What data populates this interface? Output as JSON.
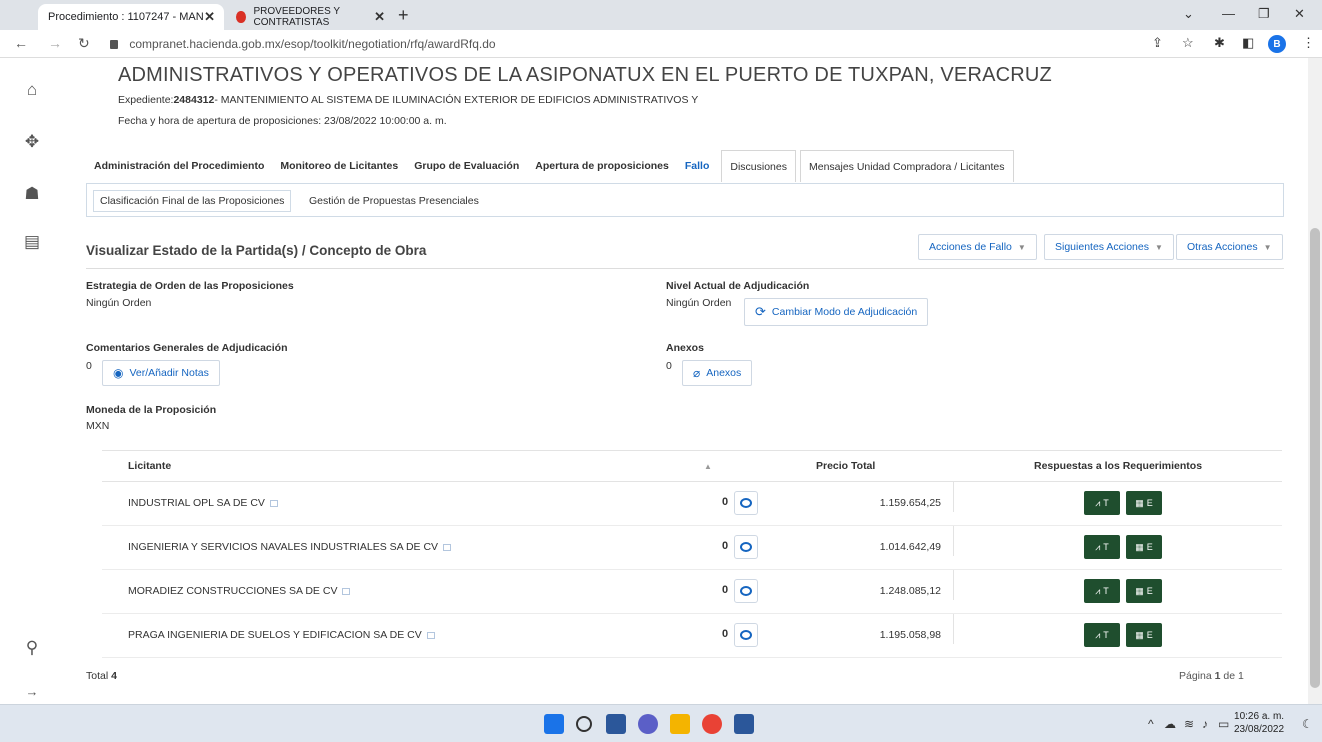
{
  "browser": {
    "tabs": [
      {
        "title": "Procedimiento : 1107247 - MAN",
        "active": true
      },
      {
        "title": "PROVEEDORES Y CONTRATISTAS",
        "active": false
      }
    ],
    "url": "compranet.hacienda.gob.mx/esop/toolkit/negotiation/rfq/awardRfq.do",
    "profile_initial": "B"
  },
  "header": {
    "title": "ADMINISTRATIVOS Y OPERATIVOS DE LA ASIPONATUX EN EL PUERTO DE TUXPAN, VERACRUZ",
    "expediente_label": "Expediente:",
    "expediente_num": "2484312",
    "expediente_desc": "- MANTENIMIENTO AL SISTEMA DE ILUMINACIÓN EXTERIOR DE EDIFICIOS ADMINISTRATIVOS Y",
    "opening_date": "Fecha y hora de apertura de proposiciones: 23/08/2022 10:00:00 a. m."
  },
  "main_tabs": [
    "Administración del Procedimiento",
    "Monitoreo de Licitantes",
    "Grupo de Evaluación",
    "Apertura de proposiciones",
    "Fallo",
    "Discusiones",
    "Mensajes Unidad Compradora / Licitantes"
  ],
  "sub_tabs": [
    "Clasificación Final de las Proposiciones",
    "Gestión de Propuestas Presenciales"
  ],
  "panel": {
    "title": "Visualizar Estado de la Partida(s) / Concepto de Obra",
    "actions": [
      "Acciones de Fallo",
      "Siguientes Acciones",
      "Otras Acciones"
    ]
  },
  "fields": {
    "strategy_label": "Estrategia de Orden de las Proposiciones",
    "strategy_value": "Ningún Orden",
    "level_label": "Nivel Actual de Adjudicación",
    "level_value": "Ningún Orden",
    "change_mode_button": "Cambiar Modo de Adjudicación",
    "comments_label": "Comentarios Generales de Adjudicación",
    "comments_count": "0",
    "notes_button": "Ver/Añadir Notas",
    "annexes_label": "Anexos",
    "annexes_count": "0",
    "annexes_button": "Anexos",
    "currency_label": "Moneda de la Proposición",
    "currency_value": "MXN"
  },
  "table": {
    "headers": {
      "bidder": "Licitante",
      "price": "Precio Total",
      "responses": "Respuestas a los Requerimientos"
    },
    "rows": [
      {
        "name": "INDUSTRIAL OPL SA DE CV",
        "count": "0",
        "price": "1.159.654,25"
      },
      {
        "name": "INGENIERIA Y SERVICIOS NAVALES INDUSTRIALES SA DE CV",
        "count": "0",
        "price": "1.014.642,49"
      },
      {
        "name": "MORADIEZ CONSTRUCCIONES SA DE CV",
        "count": "0",
        "price": "1.248.085,12"
      },
      {
        "name": "PRAGA INGENIERIA DE SUELOS Y EDIFICACION SA DE CV",
        "count": "0",
        "price": "1.195.058,98"
      }
    ],
    "resp_t": "T",
    "resp_e": "E"
  },
  "footer": {
    "total_label": "Total",
    "total_value": "4",
    "page_label": "Página",
    "page_current": "1",
    "page_of": "de 1"
  },
  "taskbar": {
    "time": "10:26 a. m.",
    "date": "23/08/2022"
  },
  "colors": {
    "link_blue": "#1565c0",
    "response_button_green": "#1f4e2e"
  }
}
